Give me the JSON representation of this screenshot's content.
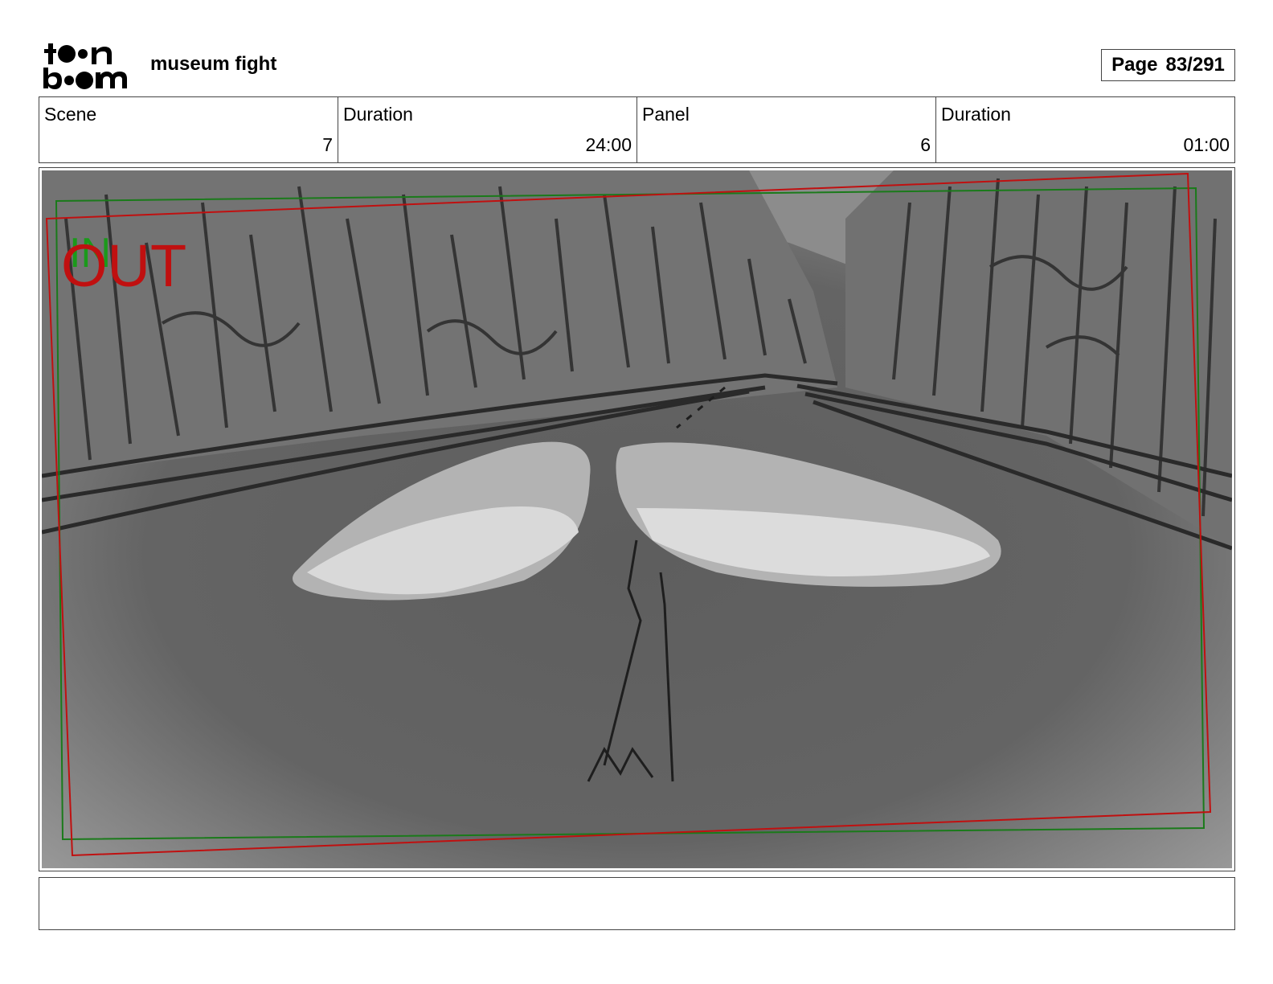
{
  "header": {
    "logo_alt": "toon boom",
    "project_title": "museum fight",
    "page_label": "Page",
    "page_value": "83/291"
  },
  "info": {
    "scene_label": "Scene",
    "scene_value": "7",
    "scene_duration_label": "Duration",
    "scene_duration_value": "24:00",
    "panel_label": "Panel",
    "panel_value": "6",
    "panel_duration_label": "Duration",
    "panel_duration_value": "01:00"
  },
  "panel": {
    "in_label": "IN",
    "out_label": "OUT",
    "colors": {
      "in": "#1a9a1a",
      "out": "#c01010",
      "background": "#6b6b6b"
    }
  },
  "notes": {
    "text": ""
  }
}
